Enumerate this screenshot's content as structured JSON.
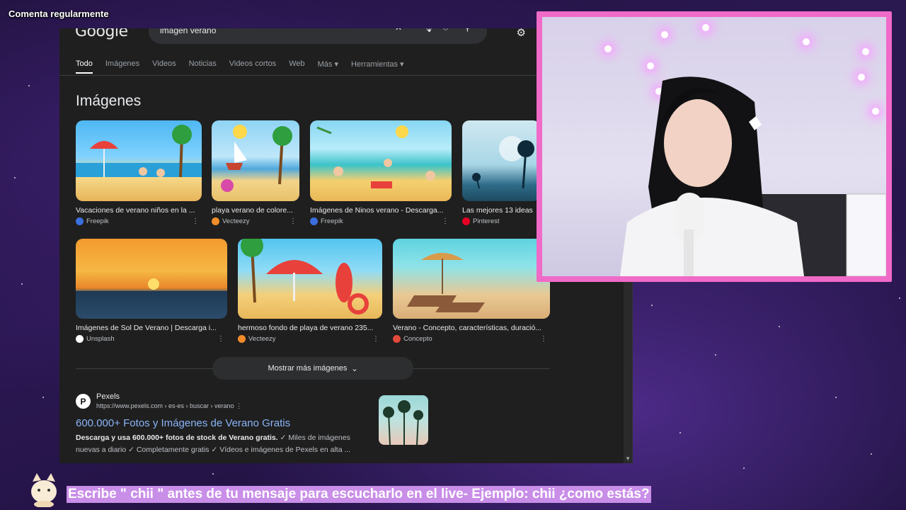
{
  "overlay": {
    "top_text": "Comenta regularmente"
  },
  "browser": {
    "logo": "Google",
    "search_query": "imagen verano",
    "tabs": [
      "Todo",
      "Imágenes",
      "Videos",
      "Noticias",
      "Videos cortos",
      "Web",
      "Más ▾",
      "Herramientas ▾"
    ],
    "section_title": "Imágenes",
    "images_row1": [
      {
        "caption": "Vacaciones de verano niños en la ...",
        "source": "Freepik",
        "favicon_color": "#3b6fe0"
      },
      {
        "caption": "playa verano de colore...",
        "source": "Vecteezy",
        "favicon_color": "#f08c2a"
      },
      {
        "caption": "Imágenes de Ninos verano - Descarga...",
        "source": "Freepik",
        "favicon_color": "#3b6fe0"
      },
      {
        "caption": "Las mejores 13 ideas",
        "source": "Pinterest",
        "favicon_color": "#e60023"
      }
    ],
    "images_row2": [
      {
        "caption": "Imágenes de Sol De Verano | Descarga i...",
        "source": "Unsplash",
        "favicon_color": "#ffffff"
      },
      {
        "caption": "hermoso fondo de playa de verano 235...",
        "source": "Vecteezy",
        "favicon_color": "#f08c2a"
      },
      {
        "caption": "Verano - Concepto, características, duració...",
        "source": "Concepto",
        "favicon_color": "#e04a3a"
      }
    ],
    "more_images_label": "Mostrar más imágenes",
    "result": {
      "site": "Pexels",
      "url": "https://www.pexels.com › es-es › buscar › verano",
      "title": "600.000+ Fotos y Imágenes de Verano Gratis",
      "desc_bold": "Descarga y usa 600.000+ fotos de stock de Verano gratis.",
      "desc_rest": " ✓ Miles de imágenes nuevas a diario ✓ Completamente gratis ✓ Vídeos e imágenes de Pexels en alta ..."
    }
  },
  "stream": {
    "caption": "Escribe \" chii \" antes de tu mensaje para escucharlo en el live- Ejemplo: chii ¿como estás?",
    "webcam_border_color": "#f06ac8"
  }
}
